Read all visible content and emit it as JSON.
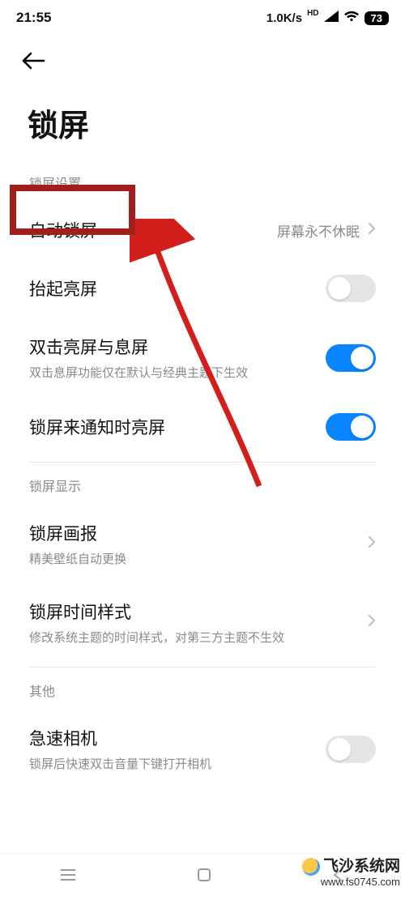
{
  "status": {
    "time": "21:55",
    "net_speed": "1.0K/s",
    "hd": "HD",
    "battery": "73"
  },
  "header": {
    "title": "锁屏"
  },
  "sections": {
    "lock_settings_label": "锁屏设置",
    "lock_display_label": "锁屏显示",
    "other_label": "其他"
  },
  "rows": {
    "auto_lock": {
      "title": "自动锁屏",
      "value": "屏幕永不休眠"
    },
    "raise_wake": {
      "title": "抬起亮屏"
    },
    "double_tap": {
      "title": "双击亮屏与息屏",
      "sub": "双击息屏功能仅在默认与经典主题下生效"
    },
    "notify_wake": {
      "title": "锁屏来通知时亮屏"
    },
    "wallpaper": {
      "title": "锁屏画报",
      "sub": "精美壁纸自动更换"
    },
    "time_style": {
      "title": "锁屏时间样式",
      "sub": "修改系统主题的时间样式，对第三方主题不生效"
    },
    "quick_camera": {
      "title": "急速相机",
      "sub": "锁屏后快速双击音量下键打开相机"
    }
  },
  "watermark": {
    "line1": "飞沙系统网",
    "line2": "www.fs0745.com"
  }
}
